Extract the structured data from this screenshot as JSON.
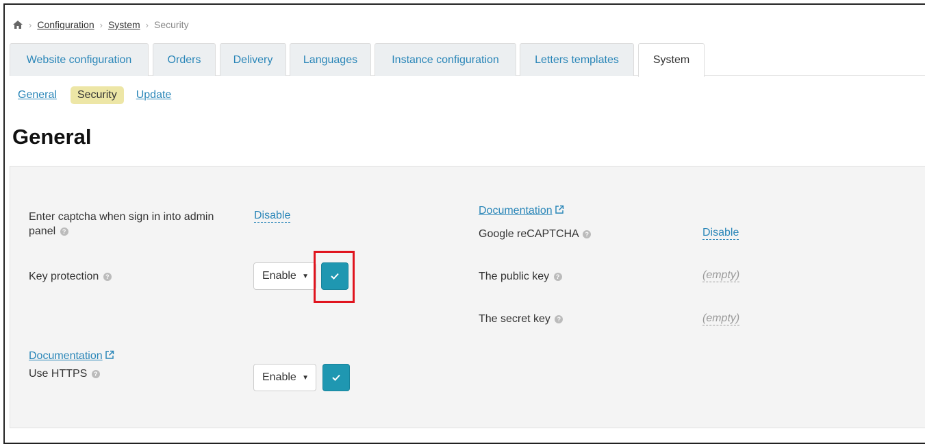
{
  "breadcrumb": {
    "home_icon": "home-icon",
    "items": [
      "Configuration",
      "System",
      "Security"
    ]
  },
  "tabs": [
    {
      "label": "Website configuration",
      "active": false
    },
    {
      "label": "Orders",
      "active": false
    },
    {
      "label": "Delivery",
      "active": false
    },
    {
      "label": "Languages",
      "active": false
    },
    {
      "label": "Instance configuration",
      "active": false
    },
    {
      "label": "Letters templates",
      "active": false
    },
    {
      "label": "System",
      "active": true
    }
  ],
  "subnav": {
    "general": "General",
    "security": "Security",
    "update": "Update"
  },
  "page_title": "General",
  "left": {
    "captcha": {
      "label_line1": "Enter captcha when sign in into admin",
      "label_line2": "panel",
      "value": "Disable"
    },
    "key_protection": {
      "label": "Key protection",
      "selected": "Enable"
    },
    "https": {
      "doc_link": "Documentation",
      "label": "Use HTTPS",
      "selected": "Enable"
    }
  },
  "right": {
    "doc_link": "Documentation",
    "recaptcha": {
      "label": "Google reCAPTCHA",
      "value": "Disable"
    },
    "public_key": {
      "label": "The public key",
      "value": "(empty)"
    },
    "secret_key": {
      "label": "The secret key",
      "value": "(empty)"
    }
  },
  "colors": {
    "link": "#2a86b8",
    "active_pill": "#ede6a6",
    "confirm_button": "#1f97b1",
    "highlight": "#e0141e"
  }
}
